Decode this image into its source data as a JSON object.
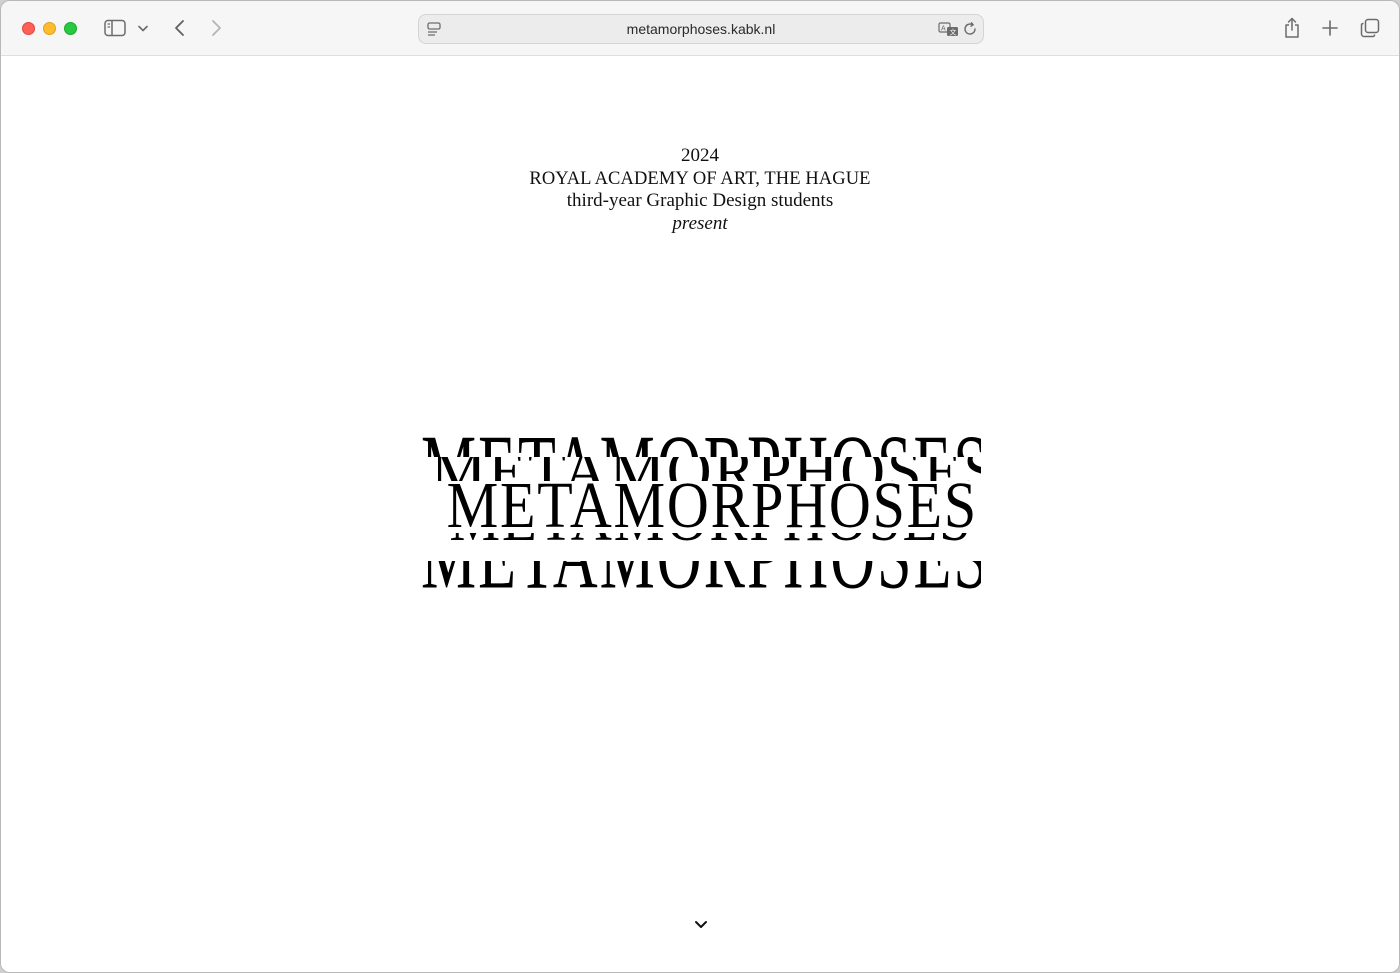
{
  "browser": {
    "url": "metamorphoses.kabk.nl",
    "icons": [
      "sidebar-icon",
      "chevron-down-icon",
      "back-icon",
      "forward-icon",
      "page-menu-icon",
      "translate-icon",
      "reload-icon",
      "share-icon",
      "new-tab-icon",
      "tab-overview-icon"
    ]
  },
  "page": {
    "year": "2024",
    "institution": "ROYAL ACADEMY OF ART, THE HAGUE",
    "subtitle": "third-year Graphic Design students",
    "present": "present",
    "title": "METAMORPHOSES",
    "scroll_icon": "chevron-down-icon"
  }
}
